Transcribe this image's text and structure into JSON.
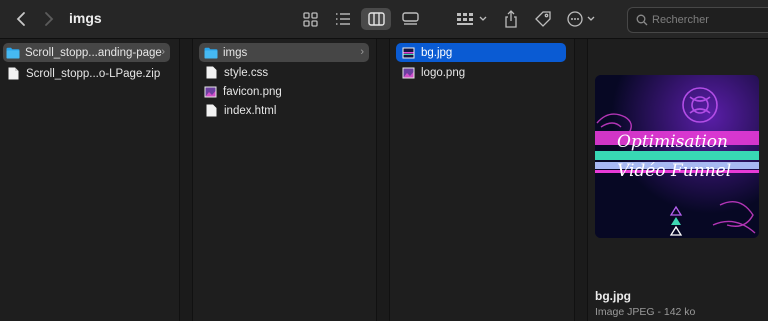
{
  "toolbar": {
    "title": "imgs",
    "search_placeholder": "Rechercher",
    "icons": [
      "back-icon",
      "forward-icon",
      "icon-view-icon",
      "list-view-icon",
      "column-view-icon",
      "gallery-view-icon",
      "group-icon",
      "share-icon",
      "tag-icon",
      "more-icon",
      "search-icon"
    ],
    "active_view": "columns"
  },
  "columns": [
    {
      "items": [
        {
          "label": "Scroll_stopp...anding-page",
          "type": "folder",
          "selected": "gray",
          "has_chevron": true
        },
        {
          "label": "Scroll_stopp...o-LPage.zip",
          "type": "file"
        }
      ]
    },
    {
      "items": [
        {
          "label": "imgs",
          "type": "folder",
          "selected": "gray",
          "has_chevron": true
        },
        {
          "label": "style.css",
          "type": "file"
        },
        {
          "label": "favicon.png",
          "type": "image"
        },
        {
          "label": "index.html",
          "type": "file"
        }
      ]
    },
    {
      "items": [
        {
          "label": "bg.jpg",
          "type": "image",
          "selected": "blue"
        },
        {
          "label": "logo.png",
          "type": "image"
        }
      ]
    }
  ],
  "preview": {
    "filename": "bg.jpg",
    "kind": "Image JPEG - 142 ko",
    "artwork_text_1": "Optimisation",
    "artwork_text_2": "Vidéo Funnel"
  },
  "colors": {
    "selection_blue": "#0a5bd3",
    "folder_blue": "#2aa5ec"
  }
}
